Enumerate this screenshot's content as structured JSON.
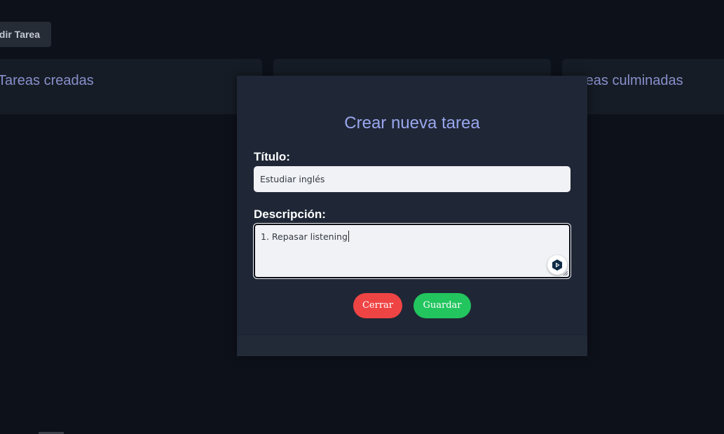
{
  "toolbar": {
    "add_task_label": "adir Tarea"
  },
  "columns": [
    {
      "title": "Tareas creadas"
    },
    {
      "title": ""
    },
    {
      "title": "reas culminadas"
    }
  ],
  "modal": {
    "title": "Crear nueva tarea",
    "title_label": "Título:",
    "title_value": "Estudiar inglés",
    "description_label": "Descripción:",
    "description_value": "1. Repasar listening",
    "close_label": "Cerrar",
    "save_label": "Guardar"
  },
  "icons": {
    "assistant": "assistant-icon",
    "resize": "resize-grip-icon"
  },
  "colors": {
    "background": "#0d111a",
    "modal_bg": "#1f2736",
    "column_bg": "#161c25",
    "accent_text": "#8790cc",
    "modal_title": "#9aa6ee",
    "close_button": "#ef4444",
    "save_button": "#22c55e"
  }
}
